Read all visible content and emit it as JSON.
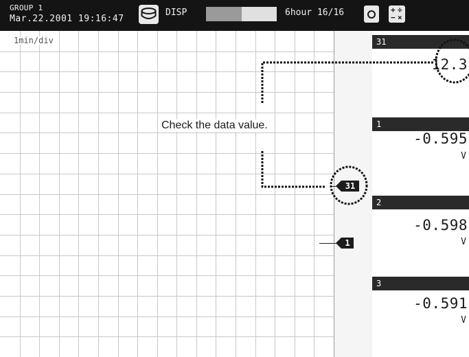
{
  "header": {
    "group": "GROUP 1",
    "datetime": "Mar.22.2001 19:16:47",
    "disp": "DISP",
    "interval": "6hour 16/16",
    "progress_fraction": 0.5
  },
  "trend": {
    "scale": "1min/div"
  },
  "markers": [
    {
      "channel": "31"
    },
    {
      "channel": "1"
    }
  ],
  "channels": [
    {
      "number": "31",
      "value": "12.3",
      "unit": ""
    },
    {
      "number": "1",
      "value": "-0.595",
      "unit": "V"
    },
    {
      "number": "2",
      "value": "-0.598",
      "unit": "V"
    },
    {
      "number": "3",
      "value": "-0.591",
      "unit": "V"
    }
  ],
  "annotation": {
    "text": "Check the data value."
  },
  "colors": {
    "bar_background": "#141414",
    "grid": "#c8c8c8",
    "marker": "#1c1c1c"
  }
}
